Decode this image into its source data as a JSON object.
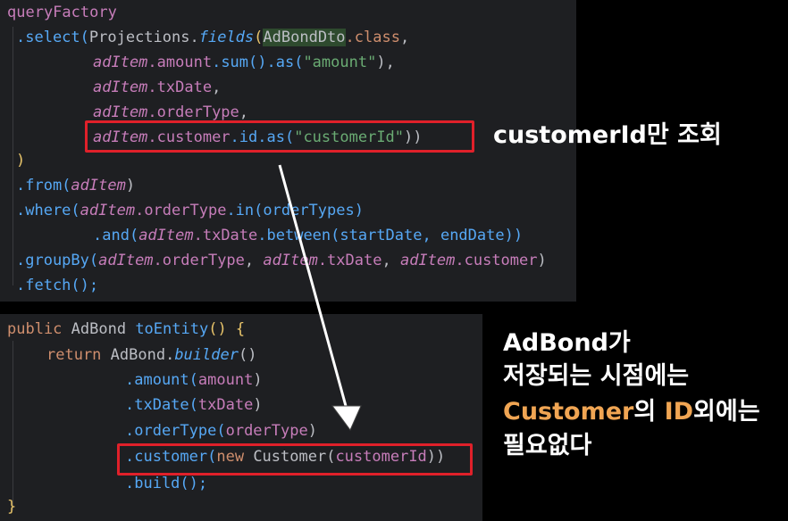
{
  "top_code": {
    "l1": "queryFactory",
    "l2_a": ".select(",
    "l2_b": "Projections",
    "l2_c": ".",
    "l2_d": "fields",
    "l2_e": "(",
    "l2_f": "AdBondDto",
    "l2_g": ".class",
    "l2_h": ",",
    "l3_a": "adItem",
    "l3_b": ".amount",
    "l3_c": ".sum().as(",
    "l3_d": "\"amount\"",
    "l3_e": "),",
    "l4_a": "adItem",
    "l4_b": ".txDate",
    "l4_c": ",",
    "l5_a": "adItem",
    "l5_b": ".orderType",
    "l5_c": ",",
    "l6_a": "adItem",
    "l6_b": ".customer",
    "l6_c": ".id.as(",
    "l6_d": "\"customerId\"",
    "l6_e": "))",
    "l7": ")",
    "l8_a": ".from(",
    "l8_b": "adItem",
    "l8_c": ")",
    "l9_a": ".where(",
    "l9_b": "adItem",
    "l9_c": ".orderType",
    "l9_d": ".in(orderTypes)",
    "l10_a": ".and(",
    "l10_b": "adItem",
    "l10_c": ".txDate",
    "l10_d": ".between(startDate, endDate))",
    "l11_a": ".groupBy(",
    "l11_b": "adItem",
    "l11_c": ".orderType",
    "l11_d": ", ",
    "l11_e": "adItem",
    "l11_f": ".txDate",
    "l11_g": ", ",
    "l11_h": "adItem",
    "l11_i": ".customer",
    "l11_j": ")",
    "l12": ".fetch();"
  },
  "bottom_code": {
    "l1_a": "public",
    "l1_b": " AdBond ",
    "l1_c": "toEntity",
    "l1_d": "() {",
    "l2_a": "return",
    "l2_b": " AdBond.",
    "l2_c": "builder",
    "l2_d": "()",
    "l3_a": ".amount(",
    "l3_b": "amount",
    "l3_c": ")",
    "l4_a": ".txDate(",
    "l4_b": "txDate",
    "l4_c": ")",
    "l5_a": ".orderType(",
    "l5_b": "orderType",
    "l5_c": ")",
    "l6_a": ".customer(",
    "l6_b": "new",
    "l6_c": " Customer(",
    "l6_d": "customerId",
    "l6_e": "))",
    "l7": ".build();",
    "l8": "}"
  },
  "captions": {
    "top": "customerId만 조회",
    "bottom_l1": "AdBond가",
    "bottom_l2": "저장되는 시점에는",
    "bottom_l3_orange1": "Customer",
    "bottom_l3_white1": "의 ",
    "bottom_l3_orange2": "ID",
    "bottom_l3_white2": "외에는",
    "bottom_l4": "필요없다"
  },
  "colors": {
    "highlight_box": "#e0202a",
    "caption_accent": "#f0a553",
    "editor_bg": "#1e1f22"
  }
}
